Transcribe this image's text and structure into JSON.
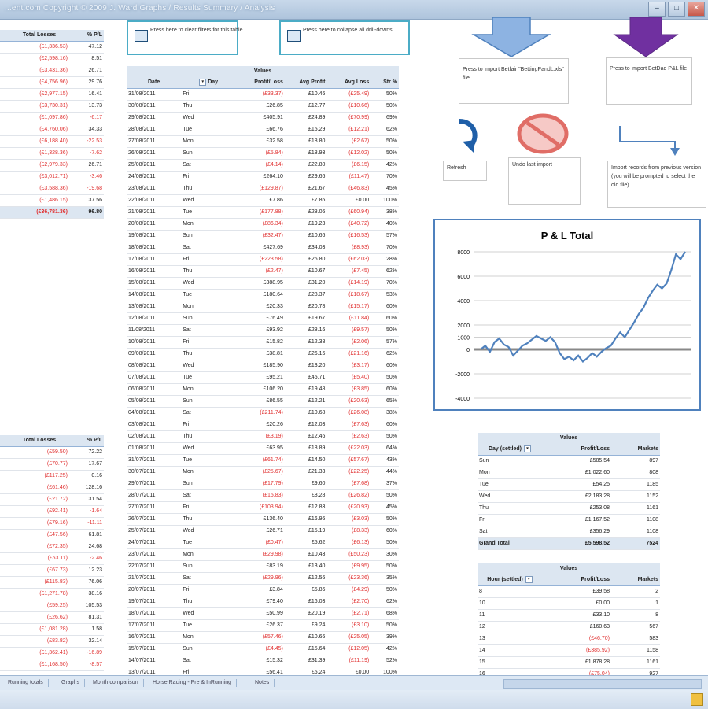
{
  "window": {
    "title": "...ent.com   Copyright © 2009 J. Ward   Graphs / Results Summary / Analysis",
    "minimize": "–",
    "maximize": "□",
    "close": "✕"
  },
  "buttons": {
    "clear_filters": "Press here to clear filters for this table",
    "collapse": "Press here to collapse all drill-downs"
  },
  "notes": {
    "betfair": "Press to import Betfair \"BettingPandL.xls\" file",
    "betdaq": "Press to import BetDaq P&L file",
    "refresh": "Refresh",
    "undo": "Undo last import",
    "import_old": "Import records from previous version (you will be prompted to select the old file)"
  },
  "left_top": {
    "headers": [
      "Total Losses",
      "% P/L"
    ],
    "rows": [
      [
        "(£1,336.53)",
        "47.12"
      ],
      [
        "(£2,598.16)",
        "8.51"
      ],
      [
        "(£3,431.36)",
        "26.71"
      ],
      [
        "(£4,756.96)",
        "29.76"
      ],
      [
        "(£2,977.15)",
        "16.41"
      ],
      [
        "(£3,730.31)",
        "13.73"
      ],
      [
        "(£1,097.86)",
        "-6.17"
      ],
      [
        "(£4,760.06)",
        "34.33"
      ],
      [
        "(£6,188.40)",
        "-22.53"
      ],
      [
        "(£1,328.36)",
        "-7.62"
      ],
      [
        "(£2,979.33)",
        "26.71"
      ],
      [
        "(£3,012.71)",
        "-3.46"
      ],
      [
        "(£3,588.36)",
        "-19.68"
      ],
      [
        "(£1,486.15)",
        "37.56"
      ]
    ],
    "total": [
      "(£36,781.36)",
      "96.80"
    ]
  },
  "left_bottom": {
    "headers": [
      "Total Losses",
      "% P/L"
    ],
    "rows": [
      [
        "(£59.50)",
        "72.22"
      ],
      [
        "(£70.77)",
        "17.67"
      ],
      [
        "(£117.25)",
        "0.16"
      ],
      [
        "(£61.46)",
        "128.16"
      ],
      [
        "(£21.72)",
        "31.54"
      ],
      [
        "(£92.41)",
        "-1.64"
      ],
      [
        "(£79.16)",
        "-11.11"
      ],
      [
        "(£47.56)",
        "61.81"
      ],
      [
        "(£72.35)",
        "24.68"
      ],
      [
        "(£63.11)",
        "-2.46"
      ],
      [
        "(£67.73)",
        "12.23"
      ],
      [
        "(£115.83)",
        "76.06"
      ],
      [
        "(£1,271.78)",
        "38.16"
      ],
      [
        "(£59.25)",
        "105.53"
      ],
      [
        "(£26.62)",
        "81.31"
      ],
      [
        "(£1,081.28)",
        "1.58"
      ],
      [
        "(£83.82)",
        "32.14"
      ],
      [
        "(£1,362.41)",
        "-16.89"
      ],
      [
        "(£1,168.50)",
        "-8.57"
      ]
    ]
  },
  "main_table": {
    "caption": "Values",
    "headers": [
      "Date",
      "Day",
      "Profit/Loss",
      "Avg Profit",
      "Avg Loss",
      "Str %"
    ],
    "rows": [
      [
        "31/08/2011",
        "Fri",
        "(£33.37)",
        "£10.46",
        "(£25.49)",
        "50%"
      ],
      [
        "30/08/2011",
        "Thu",
        "£26.85",
        "£12.77",
        "(£10.66)",
        "50%"
      ],
      [
        "29/08/2011",
        "Wed",
        "£405.91",
        "£24.89",
        "(£70.99)",
        "69%"
      ],
      [
        "28/08/2011",
        "Tue",
        "£66.76",
        "£15.29",
        "(£12.21)",
        "62%"
      ],
      [
        "27/08/2011",
        "Mon",
        "£32.58",
        "£18.80",
        "(£2.67)",
        "50%"
      ],
      [
        "26/08/2011",
        "Sun",
        "(£5.84)",
        "£18.93",
        "(£12.02)",
        "50%"
      ],
      [
        "25/08/2011",
        "Sat",
        "(£4.14)",
        "£22.80",
        "(£6.15)",
        "42%"
      ],
      [
        "24/08/2011",
        "Fri",
        "£264.10",
        "£29.66",
        "(£11.47)",
        "70%"
      ],
      [
        "23/08/2011",
        "Thu",
        "(£129.87)",
        "£21.67",
        "(£46.83)",
        "45%"
      ],
      [
        "22/08/2011",
        "Wed",
        "£7.86",
        "£7.86",
        "£0.00",
        "100%"
      ],
      [
        "21/08/2011",
        "Tue",
        "(£177.88)",
        "£28.06",
        "(£60.94)",
        "38%"
      ],
      [
        "20/08/2011",
        "Mon",
        "(£86.34)",
        "£19.23",
        "(£40.72)",
        "40%"
      ],
      [
        "19/08/2011",
        "Sun",
        "(£32.47)",
        "£10.66",
        "(£16.53)",
        "57%"
      ],
      [
        "18/08/2011",
        "Sat",
        "£427.69",
        "£34.03",
        "(£8.93)",
        "70%"
      ],
      [
        "17/08/2011",
        "Fri",
        "(£223.58)",
        "£26.80",
        "(£62.03)",
        "28%"
      ],
      [
        "16/08/2011",
        "Thu",
        "(£2.47)",
        "£10.67",
        "(£7.45)",
        "62%"
      ],
      [
        "15/08/2011",
        "Wed",
        "£388.95",
        "£31.20",
        "(£14.19)",
        "70%"
      ],
      [
        "14/08/2011",
        "Tue",
        "£180.64",
        "£28.37",
        "(£18.67)",
        "53%"
      ],
      [
        "13/08/2011",
        "Mon",
        "£20.33",
        "£20.78",
        "(£15.17)",
        "60%"
      ],
      [
        "12/08/2011",
        "Sun",
        "£76.49",
        "£19.67",
        "(£11.84)",
        "60%"
      ],
      [
        "11/08/2011",
        "Sat",
        "£93.92",
        "£28.16",
        "(£9.57)",
        "50%"
      ],
      [
        "10/08/2011",
        "Fri",
        "£15.82",
        "£12.38",
        "(£2.06)",
        "57%"
      ],
      [
        "09/08/2011",
        "Thu",
        "£38.81",
        "£26.16",
        "(£21.16)",
        "62%"
      ],
      [
        "08/08/2011",
        "Wed",
        "£185.90",
        "£13.20",
        "(£3.17)",
        "60%"
      ],
      [
        "07/08/2011",
        "Tue",
        "£95.21",
        "£45.71",
        "(£5.40)",
        "50%"
      ],
      [
        "06/08/2011",
        "Mon",
        "£106.20",
        "£19.48",
        "(£3.85)",
        "60%"
      ],
      [
        "05/08/2011",
        "Sun",
        "£86.55",
        "£12.21",
        "(£20.63)",
        "65%"
      ],
      [
        "04/08/2011",
        "Sat",
        "(£211.74)",
        "£10.68",
        "(£26.08)",
        "38%"
      ],
      [
        "03/08/2011",
        "Fri",
        "£20.26",
        "£12.03",
        "(£7.63)",
        "60%"
      ],
      [
        "02/08/2011",
        "Thu",
        "(£3.19)",
        "£12.46",
        "(£2.63)",
        "50%"
      ],
      [
        "01/08/2011",
        "Wed",
        "£63.95",
        "£18.89",
        "(£22.03)",
        "64%"
      ],
      [
        "31/07/2011",
        "Tue",
        "(£61.74)",
        "£14.50",
        "(£57.67)",
        "43%"
      ],
      [
        "30/07/2011",
        "Mon",
        "(£25.67)",
        "£21.33",
        "(£22.25)",
        "44%"
      ],
      [
        "29/07/2011",
        "Sun",
        "(£17.79)",
        "£9.60",
        "(£7.68)",
        "37%"
      ],
      [
        "28/07/2011",
        "Sat",
        "(£15.83)",
        "£8.28",
        "(£26.82)",
        "50%"
      ],
      [
        "27/07/2011",
        "Fri",
        "(£103.94)",
        "£12.83",
        "(£20.93)",
        "45%"
      ],
      [
        "26/07/2011",
        "Thu",
        "£136.40",
        "£16.96",
        "(£3.03)",
        "50%"
      ],
      [
        "25/07/2011",
        "Wed",
        "£26.71",
        "£15.19",
        "(£8.33)",
        "60%"
      ],
      [
        "24/07/2011",
        "Tue",
        "(£0.47)",
        "£5.62",
        "(£6.13)",
        "50%"
      ],
      [
        "23/07/2011",
        "Mon",
        "(£29.98)",
        "£10.43",
        "(£50.23)",
        "30%"
      ],
      [
        "22/07/2011",
        "Sun",
        "£83.19",
        "£13.40",
        "(£9.95)",
        "50%"
      ],
      [
        "21/07/2011",
        "Sat",
        "(£29.96)",
        "£12.56",
        "(£23.36)",
        "35%"
      ],
      [
        "20/07/2011",
        "Fri",
        "£3.84",
        "£5.86",
        "(£4.29)",
        "50%"
      ],
      [
        "19/07/2011",
        "Thu",
        "£79.40",
        "£16.03",
        "(£2.70)",
        "62%"
      ],
      [
        "18/07/2011",
        "Wed",
        "£50.99",
        "£20.19",
        "(£2.71)",
        "68%"
      ],
      [
        "17/07/2011",
        "Tue",
        "£26.37",
        "£9.24",
        "(£3.10)",
        "50%"
      ],
      [
        "16/07/2011",
        "Mon",
        "(£57.46)",
        "£10.66",
        "(£25.05)",
        "39%"
      ],
      [
        "15/07/2011",
        "Sun",
        "(£4.45)",
        "£15.64",
        "(£12.05)",
        "42%"
      ],
      [
        "14/07/2011",
        "Sat",
        "£15.32",
        "£31.39",
        "(£11.19)",
        "52%"
      ],
      [
        "13/07/2011",
        "Fri",
        "£56.41",
        "£5.24",
        "£0.00",
        "100%"
      ]
    ]
  },
  "day_table": {
    "caption": "Values",
    "headers": [
      "Day (settled)",
      "Profit/Loss",
      "Markets"
    ],
    "rows": [
      [
        "Sun",
        "£585.54",
        "897"
      ],
      [
        "Mon",
        "£1,022.60",
        "808"
      ],
      [
        "Tue",
        "£54.25",
        "1185"
      ],
      [
        "Wed",
        "£2,183.28",
        "1152"
      ],
      [
        "Thu",
        "£253.08",
        "1161"
      ],
      [
        "Fri",
        "£1,167.52",
        "1108"
      ],
      [
        "Sat",
        "£356.29",
        "1108"
      ]
    ],
    "total": [
      "Grand Total",
      "£5,598.52",
      "7524"
    ]
  },
  "hour_table": {
    "caption": "Values",
    "headers": [
      "Hour (settled)",
      "Profit/Loss",
      "Markets"
    ],
    "rows": [
      [
        "8",
        "£39.58",
        "2"
      ],
      [
        "10",
        "£0.00",
        "1"
      ],
      [
        "11",
        "£33.10",
        "8"
      ],
      [
        "12",
        "£160.63",
        "567"
      ],
      [
        "13",
        "(£46.70)",
        "583"
      ],
      [
        "14",
        "(£385.92)",
        "1158"
      ],
      [
        "15",
        "£1,878.28",
        "1161"
      ],
      [
        "16",
        "(£75.04)",
        "927"
      ]
    ]
  },
  "chart_data": {
    "type": "line",
    "title": "P & L Total",
    "ylim": [
      -4000,
      8000
    ],
    "yticks": [
      8000,
      6000,
      4000,
      2000,
      1000,
      0,
      -2000,
      -4000
    ],
    "series": [
      {
        "values": [
          0,
          300,
          -200,
          600,
          900,
          400,
          200,
          -500,
          -100,
          300,
          500,
          800,
          1100,
          900,
          700,
          1000,
          600,
          -300,
          -800,
          -600,
          -900,
          -500,
          -1000,
          -700,
          -300,
          -600,
          -200,
          100,
          300,
          900,
          1400,
          1000,
          1600,
          2200,
          2900,
          3400,
          4200,
          4800,
          5300,
          5000,
          5400,
          6500,
          7800,
          7400,
          8000
        ]
      }
    ],
    "grid": true,
    "color": "#4f81bd"
  },
  "sheet_tabs": [
    "Running totals",
    "Graphs",
    "Month comparison",
    "Horse Racing - Pre & InRunning",
    "Notes"
  ]
}
